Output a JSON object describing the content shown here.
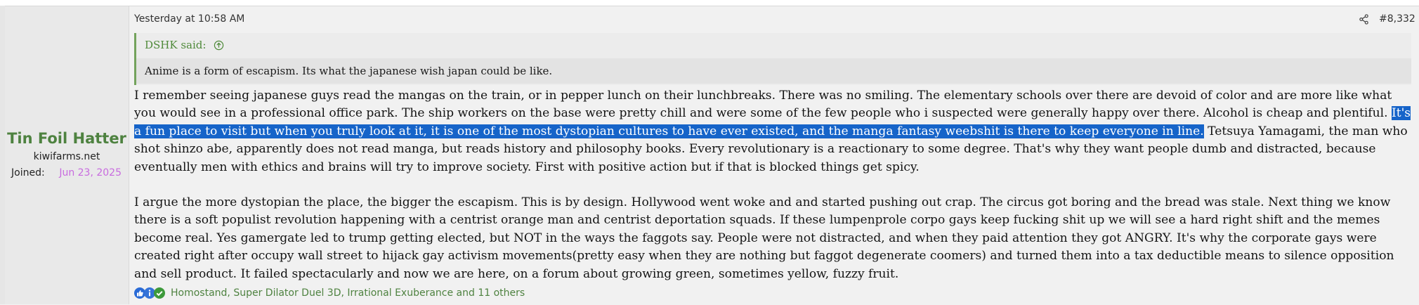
{
  "user": {
    "name": "Tin Foil Hatter",
    "site": "kiwifarms.net",
    "joined_label": "Joined:",
    "joined_date": "Jun 23, 2025"
  },
  "post": {
    "date": "Yesterday at 10:58 AM",
    "number": "#8,332",
    "quote": {
      "author": "DSHK said:",
      "text": "Anime is a form of escapism. Its what the japanese wish japan could be like."
    },
    "paragraph1_a": "I remember seeing japanese guys read the mangas on the train, or in pepper lunch on their lunchbreaks. There was no smiling. The elementary schools over there are devoid of color and are more like what you would see in a professional office park. The ship workers on the base were pretty chill and were some of the few people who i suspected were generally happy over there. Alcohol is cheap and plentiful. ",
    "paragraph1_highlight": "It's a fun place to visit but when you truly look at it, it is one of the most dystopian cultures to have ever existed, and the manga fantasy weebshit is there to keep everyone in line.",
    "paragraph1_b": " Tetsuya Yamagami, the man who shot shinzo abe, apparently does not read manga, but reads history and philosophy books. Every revolutionary is a reactionary to some degree. That's why they want people dumb and distracted, because eventually men with ethics and brains will try to improve society. First with positive action but if that is blocked things get spicy.",
    "paragraph2": "I argue the more dystopian the place, the bigger the escapism. This is by design. Hollywood went woke and and started pushing out crap. The circus got boring and the bread was stale. Next thing we know there is a soft populist revolution happening with a centrist orange man and centrist deportation squads. If these lumpenprole corpo gays keep fucking shit up we will see a hard right shift and the memes become real. Yes gamergate led to trump getting elected, but NOT in the ways the faggots say. People were not distracted, and when they paid attention they got ANGRY. It's why the corporate gays were created right after occupy wall street to hijack gay activism movements(pretty easy when they are nothing but faggot degenerate coomers) and turned them into a tax deductible means to silence opposition and sell product. It failed spectacularly and now we are here, on a forum about growing green, sometimes yellow, fuzzy fruit.",
    "reactions": {
      "icons": [
        "thumbs-up-icon",
        "info-icon",
        "check-icon"
      ],
      "text": "Homostand, Super Dilator Duel 3D, Irrational Exuberance and 11 others"
    }
  },
  "colors": {
    "username": "#4e8240",
    "joined_date": "#c86bdf",
    "highlight": "#1664c9",
    "quote_border": "#73a35c"
  }
}
